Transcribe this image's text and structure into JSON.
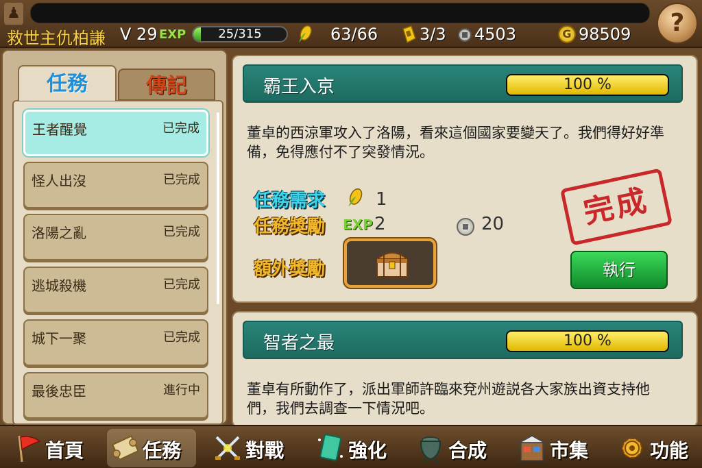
{
  "player": {
    "name": "救世主仇柏謙",
    "level": "V 29",
    "exp_tag": "EXP",
    "exp_text": "25/315",
    "exp_fraction": 0.079,
    "stamina": "63/66",
    "tokens": "3/3",
    "silver": "4503",
    "gold": "98509",
    "gold_icon_letter": "G"
  },
  "help": {
    "label": "?"
  },
  "tabs": {
    "quests": "任務",
    "biography": "傳記"
  },
  "quest_list": [
    {
      "title": "王者醒覺",
      "status": "已完成",
      "selected": true
    },
    {
      "title": "怪人出沒",
      "status": "已完成"
    },
    {
      "title": "洛陽之亂",
      "status": "已完成"
    },
    {
      "title": "逃城殺機",
      "status": "已完成"
    },
    {
      "title": "城下一聚",
      "status": "已完成"
    },
    {
      "title": "最後忠臣",
      "status": "進行中"
    }
  ],
  "quest_cards": [
    {
      "title": "霸王入京",
      "progress_text": "100 %",
      "progress_fraction": 1.0,
      "description": "董卓的西涼軍攻入了洛陽，看來這個國家要變天了。我們得好好準備，免得應付不了突發情況。",
      "requirement_label": "任務需求",
      "requirement_value": "1",
      "reward_label": "任務獎勵",
      "reward_exp_tag": "EXP",
      "reward_exp": "2",
      "reward_coin": "20",
      "extra_label": "額外獎勵",
      "stamp": "完成",
      "execute_label": "執行"
    },
    {
      "title": "智者之最",
      "progress_text": "100 %",
      "progress_fraction": 1.0,
      "description": "董卓有所動作了，派出軍師許臨來兗州遊説各大家族出資支持他們，我們去調查一下情況吧。"
    }
  ],
  "nav": [
    {
      "label": "首頁",
      "icon": "flag-icon"
    },
    {
      "label": "任務",
      "icon": "scroll-icon",
      "active": true
    },
    {
      "label": "對戰",
      "icon": "crossed-swords-icon"
    },
    {
      "label": "強化",
      "icon": "gem-card-icon"
    },
    {
      "label": "合成",
      "icon": "cauldron-icon"
    },
    {
      "label": "市集",
      "icon": "market-stall-icon"
    },
    {
      "label": "功能",
      "icon": "gear-icon"
    }
  ],
  "colors": {
    "accent_teal": "#1d6a60",
    "progress_yellow": "#e0b800",
    "stamp_red": "#c8282a",
    "execute_green": "#0f8a2a"
  }
}
